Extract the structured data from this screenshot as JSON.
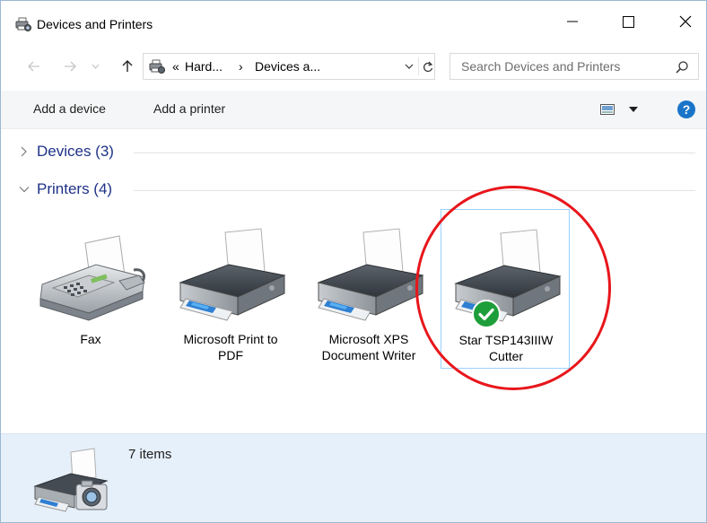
{
  "window": {
    "title": "Devices and Printers"
  },
  "address": {
    "overflow": "«",
    "crumbs": [
      "Hard...",
      "Devices a..."
    ],
    "separator": "›"
  },
  "search": {
    "placeholder": "Search Devices and Printers"
  },
  "commands": {
    "add_device": "Add a device",
    "add_printer": "Add a printer",
    "help": "?"
  },
  "groups": {
    "devices": {
      "label": "Devices (3)",
      "expanded": false
    },
    "printers": {
      "label": "Printers (4)",
      "expanded": true
    }
  },
  "printers": [
    {
      "label_line1": "Fax",
      "label_line2": "",
      "icon": "fax-icon",
      "selected": false,
      "default": false
    },
    {
      "label_line1": "Microsoft Print to",
      "label_line2": "PDF",
      "icon": "printer-icon",
      "selected": false,
      "default": false
    },
    {
      "label_line1": "Microsoft XPS",
      "label_line2": "Document Writer",
      "icon": "printer-icon",
      "selected": false,
      "default": false
    },
    {
      "label_line1": "Star TSP143IIIW",
      "label_line2": "Cutter",
      "icon": "printer-icon",
      "selected": true,
      "default": true
    }
  ],
  "details": {
    "count_text": "7 items",
    "icon": "devices-and-printers-icon"
  },
  "colors": {
    "group_title": "#1e3287",
    "selection_border": "#99d1ff",
    "annotation": "#e8161b",
    "default_check": "#1e9e3a",
    "details_bg": "#e6f0fa"
  }
}
